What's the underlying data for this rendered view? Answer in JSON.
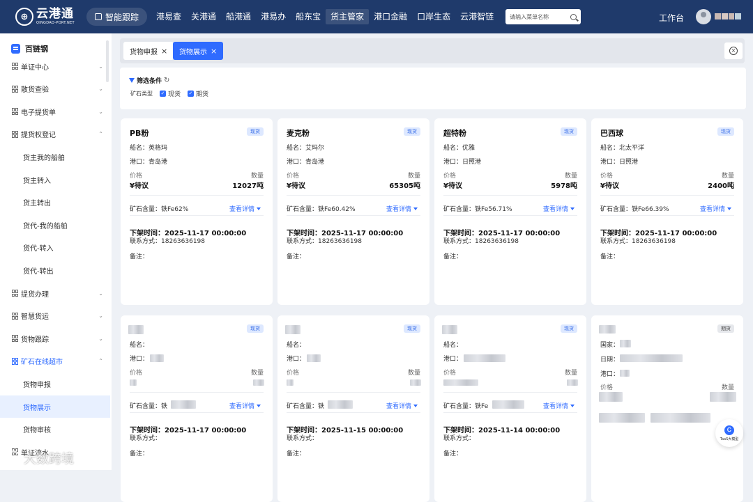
{
  "header": {
    "logo_title": "云港通",
    "logo_sub": "QINGDAO-PORT.NET",
    "track_label": "智能跟踪",
    "nav": [
      "港易查",
      "关港通",
      "船港通",
      "港易办",
      "船东宝",
      "货主管家",
      "港口金融",
      "口岸生态",
      "云港智链"
    ],
    "active_nav": "货主管家",
    "search_placeholder": "请输入菜单名称",
    "workbench": "工作台"
  },
  "sidebar": {
    "title": "百链钢",
    "items": [
      {
        "label": "单证中心",
        "level": 1,
        "chevron": "⌄"
      },
      {
        "label": "散货查验",
        "level": 1,
        "chevron": "⌄"
      },
      {
        "label": "电子提货单",
        "level": 1,
        "chevron": "⌄"
      },
      {
        "label": "提货权登记",
        "level": 1,
        "chevron": "⌃"
      },
      {
        "label": "货主我的船舶",
        "level": 2
      },
      {
        "label": "货主转入",
        "level": 2
      },
      {
        "label": "货主转出",
        "level": 2
      },
      {
        "label": "货代-我的船舶",
        "level": 2
      },
      {
        "label": "货代-转入",
        "level": 2
      },
      {
        "label": "货代-转出",
        "level": 2
      },
      {
        "label": "提货办理",
        "level": 1,
        "chevron": "⌄"
      },
      {
        "label": "智慧货运",
        "level": 1,
        "chevron": "⌄"
      },
      {
        "label": "货物跟踪",
        "level": 1,
        "chevron": "⌄"
      },
      {
        "label": "矿石在线超市",
        "level": 1,
        "chevron": "⌃"
      },
      {
        "label": "货物申报",
        "level": 2
      },
      {
        "label": "货物展示",
        "level": 2
      },
      {
        "label": "货物审核",
        "level": 2
      },
      {
        "label": "单证流水",
        "level": 1
      }
    ],
    "selected": "货物展示"
  },
  "tabs": [
    {
      "label": "货物申报",
      "active": false
    },
    {
      "label": "货物展示",
      "active": true
    }
  ],
  "filter": {
    "title": "筛选条件",
    "type_label": "矿石类型",
    "options": [
      {
        "label": "现货",
        "checked": true
      },
      {
        "label": "期货",
        "checked": true
      }
    ]
  },
  "labels": {
    "ship": "船名：",
    "port": "港口：",
    "price": "价格",
    "qty": "数量",
    "ore": "矿石含量：",
    "detail": "查看详情",
    "offtime": "下架时间：",
    "contact": "联系方式：",
    "remark": "备注：",
    "country": "国家：",
    "date": "日期：",
    "port_short": "港口："
  },
  "cards": [
    {
      "name": "PB粉",
      "badge": "现货",
      "ship": "英格玛",
      "port": "青岛港",
      "price": "¥待议",
      "qty": "12027吨",
      "ore": "铁Fe62%",
      "offtime": "2025-11-17 00:00:00",
      "contact": "18263636198"
    },
    {
      "name": "麦克粉",
      "badge": "现货",
      "ship": "艾玛尔",
      "port": "青岛港",
      "price": "¥待议",
      "qty": "65305吨",
      "ore": "铁Fe60.42%",
      "offtime": "2025-11-17 00:00:00",
      "contact": "18263636198"
    },
    {
      "name": "超特粉",
      "badge": "现货",
      "ship": "优雅",
      "port": "日照港",
      "price": "¥待议",
      "qty": "5978吨",
      "ore": "铁Fe56.71%",
      "offtime": "2025-11-17 00:00:00",
      "contact": "18263636198"
    },
    {
      "name": "巴西球",
      "badge": "现货",
      "ship": "北太平洋",
      "port": "日照港",
      "price": "¥待议",
      "qty": "2400吨",
      "ore": "铁Fe66.39%",
      "offtime": "2025-11-17 00:00:00",
      "contact": "18263636198"
    },
    {
      "badge": "现货",
      "ore_prefix": "铁",
      "offtime": "2025-11-17 00:00:00"
    },
    {
      "badge": "现货",
      "ore_prefix": "铁",
      "offtime": "2025-11-15 00:00:00"
    },
    {
      "badge": "现货",
      "ore_prefix": "铁Fe",
      "offtime": "2025-11-14 00:00:00"
    },
    {
      "badge": "期货"
    }
  ],
  "taas": "TaaS大模型",
  "watermark": "大数跨境",
  "colors": {
    "header": "#1f3a6b",
    "accent": "#2f6bff",
    "page_bg": "#eef1f6"
  }
}
